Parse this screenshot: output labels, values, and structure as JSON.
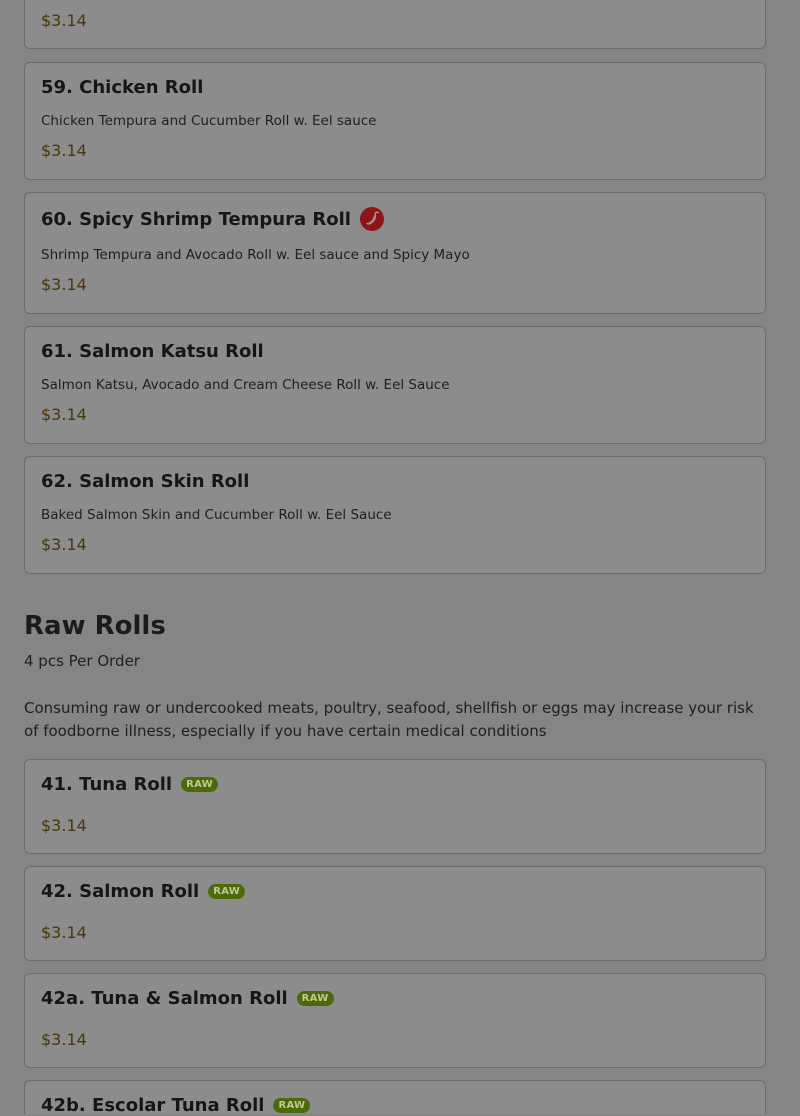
{
  "top_card": {
    "price": "$3.14"
  },
  "baked_items": [
    {
      "name": "59. Chicken Roll",
      "description": "Chicken Tempura and Cucumber Roll w. Eel sauce",
      "price": "$3.14"
    },
    {
      "name": "60. Spicy Shrimp Tempura Roll",
      "description": "Shrimp Tempura and Avocado Roll w. Eel sauce and Spicy Mayo",
      "price": "$3.14",
      "icon": "spicy-chili-icon"
    },
    {
      "name": "61. Salmon Katsu Roll",
      "description": "Salmon Katsu, Avocado and Cream Cheese Roll w. Eel Sauce",
      "price": "$3.14"
    },
    {
      "name": "62. Salmon Skin Roll",
      "description": "Baked Salmon Skin and Cucumber Roll w. Eel Sauce",
      "price": "$3.14"
    }
  ],
  "raw_section": {
    "title": "Raw Rolls",
    "subtitle": "4 pcs Per Order",
    "warning": "Consuming raw or undercooked meats, poultry, seafood, shellfish or eggs may increase your risk of foodborne illness, especially if you have certain medical conditions",
    "badge_label": "RAW",
    "items": [
      {
        "name": "41. Tuna Roll",
        "price": "$3.14"
      },
      {
        "name": "42. Salmon Roll",
        "price": "$3.14"
      },
      {
        "name": "42a. Tuna & Salmon Roll",
        "price": "$3.14"
      },
      {
        "name": "42b. Escolar Tuna Roll"
      }
    ]
  },
  "colors": {
    "overlay_background": "#858585",
    "card_background": "#8c8c8c",
    "price_text": "#4a3608",
    "raw_badge": "#4c6a0c",
    "spicy_icon": "#8c1616"
  }
}
